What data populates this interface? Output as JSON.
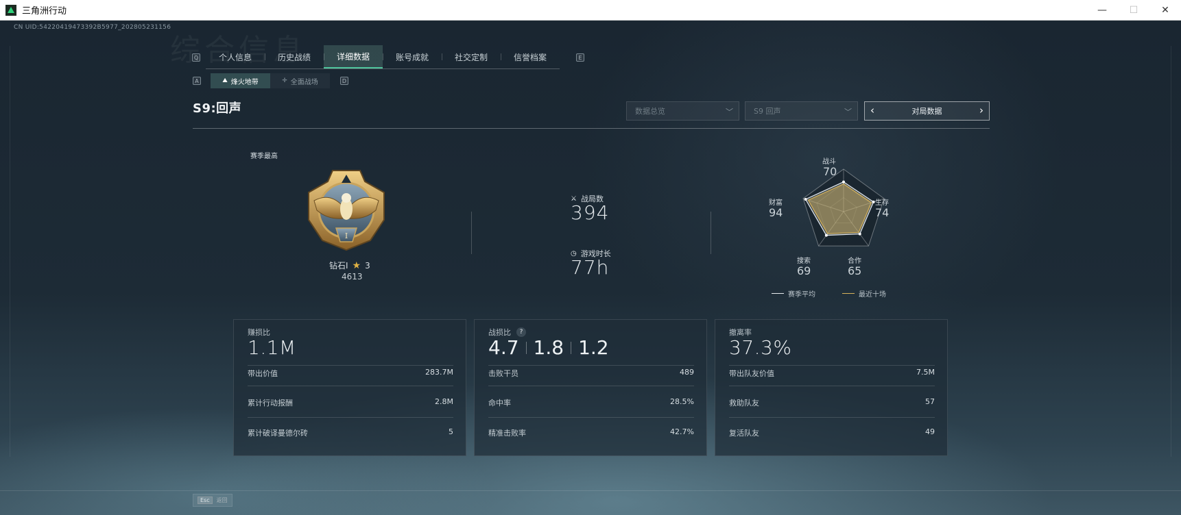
{
  "window": {
    "title": "三角洲行动",
    "minimize": "—",
    "maximize": "☐",
    "close": "✕"
  },
  "header": {
    "uid": "CN UID:54220419473392B5977_202805231156",
    "bg_heading": "综合信息"
  },
  "nav": {
    "key_left": "Q",
    "key_right": "E",
    "tabs": [
      "个人信息",
      "历史战绩",
      "详细数据",
      "账号成就",
      "社交定制",
      "信誉档案"
    ],
    "active_tab": "详细数据"
  },
  "subnav": {
    "key_left": "A",
    "key_right": "D",
    "tabs": [
      {
        "label": "烽火地带",
        "icon": "mountain-icon"
      },
      {
        "label": "全面战场",
        "icon": "crosshair-icon"
      }
    ],
    "active_tab": "烽火地带"
  },
  "season": {
    "title": "S9:回声",
    "filter_1": "数据总览",
    "filter_2": "S9 回声",
    "match_data_label": "对局数据"
  },
  "rank": {
    "section_label": "赛季最高",
    "name": "钻石I",
    "stars": "3",
    "score": "4613"
  },
  "stats": {
    "matches_label": "战局数",
    "matches_value": "394",
    "playtime_label": "游戏时长",
    "playtime_value": "77h"
  },
  "radar": {
    "axes": [
      {
        "label": "战斗",
        "value": 70,
        "display": "70"
      },
      {
        "label": "生存",
        "value": 74,
        "display": "74"
      },
      {
        "label": "合作",
        "value": 65,
        "display": "65"
      },
      {
        "label": "搜索",
        "value": 69,
        "display": "69"
      },
      {
        "label": "财富",
        "value": 94,
        "display": "94"
      }
    ],
    "legend_avg": "赛季平均",
    "legend_recent": "最近十场",
    "color_avg": "#e8ecef",
    "color_recent": "#d8b35a"
  },
  "cards": {
    "profit": {
      "title": "赚损比",
      "big": "1.1M",
      "rows": [
        {
          "label": "带出价值",
          "value": "283.7M"
        },
        {
          "label": "累计行动报酬",
          "value": "2.8M"
        },
        {
          "label": "累计破译曼德尔砖",
          "value": "5"
        }
      ]
    },
    "kd": {
      "title": "战损比",
      "help": "?",
      "values": [
        "4.7",
        "1.8",
        "1.2"
      ],
      "rows": [
        {
          "label": "击败干员",
          "value": "489"
        },
        {
          "label": "命中率",
          "value": "28.5%"
        },
        {
          "label": "精准击败率",
          "value": "42.7%"
        }
      ]
    },
    "extract": {
      "title": "撤离率",
      "big": "37.3%",
      "rows": [
        {
          "label": "带出队友价值",
          "value": "7.5M"
        },
        {
          "label": "救助队友",
          "value": "57"
        },
        {
          "label": "复活队友",
          "value": "49"
        }
      ]
    }
  },
  "footer": {
    "esc_key": "Esc",
    "esc_label": "返回"
  }
}
